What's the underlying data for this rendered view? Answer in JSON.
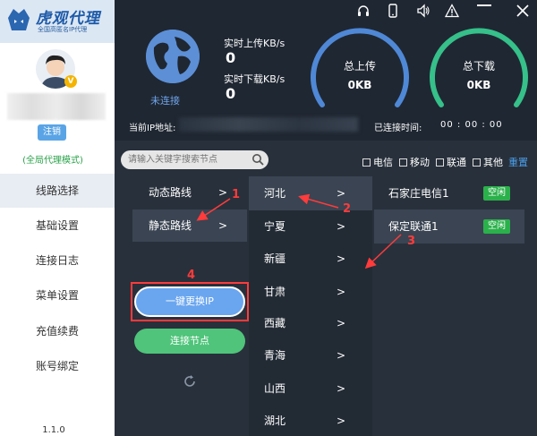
{
  "app": {
    "logo_title": "虎观代理",
    "logo_subtitle": "全国高匿名IP代理",
    "vip_badge": "V",
    "logout": "注销",
    "mode": "(全局代理模式)",
    "version": "1.1.0"
  },
  "sidebar": {
    "items": [
      {
        "label": "线路选择",
        "active": true
      },
      {
        "label": "基础设置",
        "active": false
      },
      {
        "label": "连接日志",
        "active": false
      },
      {
        "label": "菜单设置",
        "active": false
      },
      {
        "label": "充值续费",
        "active": false
      },
      {
        "label": "账号绑定",
        "active": false
      }
    ]
  },
  "status": {
    "connection": "未连接",
    "upload_label": "实时上传KB/s",
    "upload_value": "0",
    "download_label": "实时下载KB/s",
    "download_value": "0",
    "total_upload_label": "总上传",
    "total_upload_value": "0KB",
    "total_download_label": "总下载",
    "total_download_value": "0KB",
    "ip_label": "当前IP地址:",
    "time_label": "已连接时间:",
    "time_value": "00 : 00 : 00"
  },
  "search": {
    "placeholder": "请输入关键字搜索节点"
  },
  "filters": [
    "电信",
    "移动",
    "联通",
    "其他"
  ],
  "reset": "重置",
  "routes": [
    {
      "label": "动态路线",
      "arrow": ">"
    },
    {
      "label": "静态路线",
      "arrow": ">"
    }
  ],
  "provinces": [
    {
      "label": "河北",
      "arrow": ">"
    },
    {
      "label": "宁夏",
      "arrow": ">"
    },
    {
      "label": "新疆",
      "arrow": ">"
    },
    {
      "label": "甘肃",
      "arrow": ">"
    },
    {
      "label": "西藏",
      "arrow": ">"
    },
    {
      "label": "青海",
      "arrow": ">"
    },
    {
      "label": "山西",
      "arrow": ">"
    },
    {
      "label": "湖北",
      "arrow": ">"
    }
  ],
  "nodes": [
    {
      "label": "石家庄电信1",
      "status": "空闲"
    },
    {
      "label": "保定联通1",
      "status": "空闲"
    }
  ],
  "buttons": {
    "switch_ip": "一键更换IP",
    "connect": "连接节点"
  },
  "annotations": [
    "1",
    "2",
    "3",
    "4"
  ],
  "colors": {
    "accent_blue": "#4a9eea",
    "gauge_green": "#36c08a",
    "status_green": "#2bb14b",
    "annotation_red": "#ff3b3b"
  }
}
